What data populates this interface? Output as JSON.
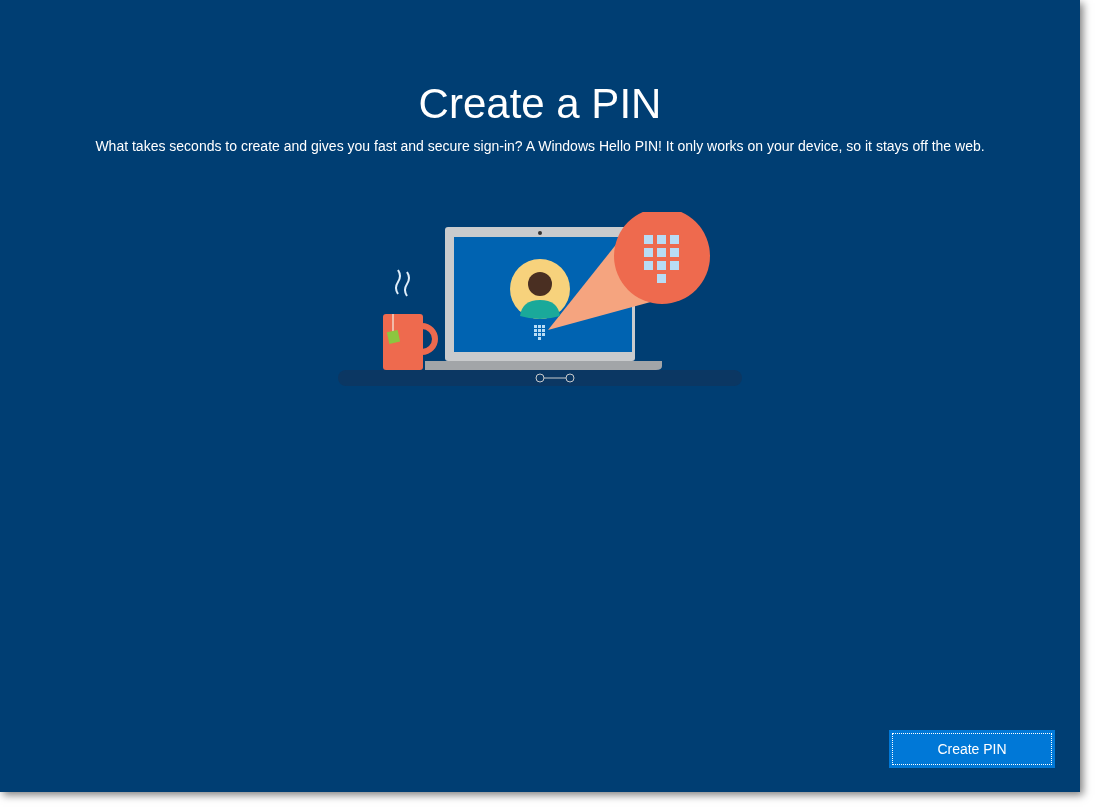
{
  "title": "Create a PIN",
  "description": "What takes seconds to create and gives you fast and secure sign-in? A Windows Hello PIN! It only works on your device, so it stays off the web.",
  "buttons": [
    {
      "label": "Create PIN",
      "focused": true
    }
  ]
}
